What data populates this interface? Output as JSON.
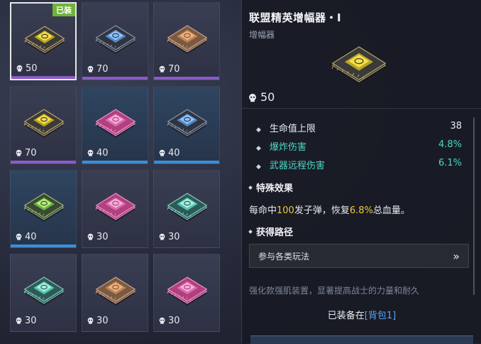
{
  "colors": {
    "purple_bar": "#8b5cc8",
    "blue_bar": "#3b8ed8",
    "teal": "#4fd6c3",
    "highlight": "#f2c83a",
    "link": "#57a6ff",
    "equipped_badge": "#6fb33a"
  },
  "inventory": [
    {
      "cost": "50",
      "chip": "gold",
      "rarity": "purple",
      "badge": "已装",
      "selected": true
    },
    {
      "cost": "70",
      "chip": "blue",
      "rarity": "purple"
    },
    {
      "cost": "70",
      "chip": "bronze",
      "rarity": "purple"
    },
    {
      "cost": "70",
      "chip": "gold",
      "rarity": "purple"
    },
    {
      "cost": "40",
      "chip": "pink",
      "rarity": "blue"
    },
    {
      "cost": "40",
      "chip": "blue",
      "rarity": "blue"
    },
    {
      "cost": "40",
      "chip": "green",
      "rarity": "blue"
    },
    {
      "cost": "30",
      "chip": "pink",
      "rarity": "none"
    },
    {
      "cost": "30",
      "chip": "teal",
      "rarity": "none"
    },
    {
      "cost": "30",
      "chip": "teal",
      "rarity": "none"
    },
    {
      "cost": "30",
      "chip": "bronze",
      "rarity": "none"
    },
    {
      "cost": "30",
      "chip": "pink",
      "rarity": "none"
    }
  ],
  "detail": {
    "title": "联盟精英增幅器・Ⅰ",
    "subtitle": "增幅器",
    "cost": "50",
    "stats": [
      {
        "name": "生命值上限",
        "value": "38",
        "teal": false
      },
      {
        "name": "爆炸伤害",
        "value": "4.8%",
        "teal": true
      },
      {
        "name": "武器远程伤害",
        "value": "6.1%",
        "teal": true
      }
    ],
    "special_title": "特殊效果",
    "effect": {
      "p1": "每命中",
      "n1": "100",
      "p2": "发子弹，恢复",
      "n2": "6.8%",
      "p3": "总血量。"
    },
    "source_title": "获得路径",
    "source_label": "参与各类玩法",
    "source_arrow": "»",
    "description": "强化款强肌装置，显著提高战士的力量和耐久",
    "equipped_prefix": "已装备在",
    "equipped_location": "[背包1]"
  }
}
